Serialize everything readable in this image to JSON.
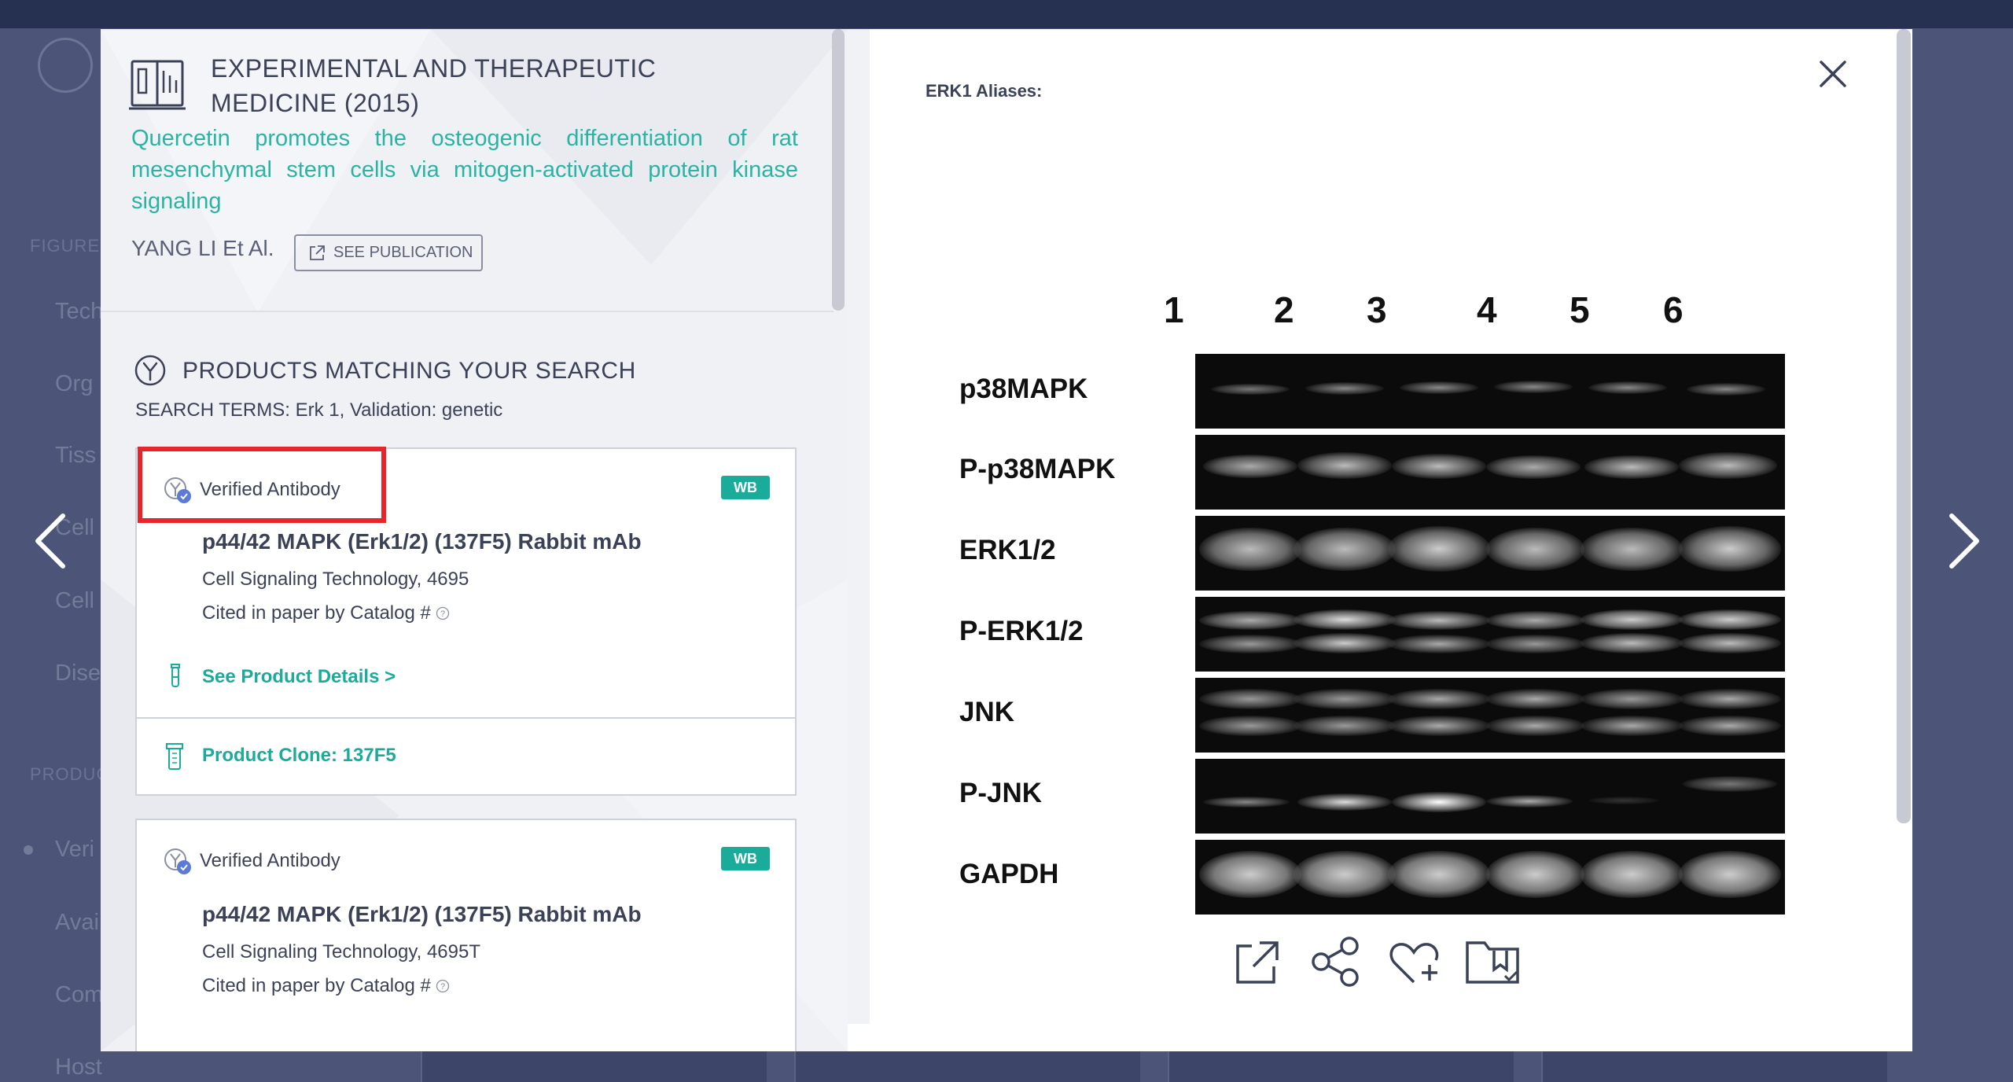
{
  "background": {
    "sidebar_heading_figures": "FIGURES",
    "sidebar_heading_products": "PRODUCTS",
    "sidebar_items": [
      "Tech",
      "Org",
      "Tiss",
      "Cell",
      "Cell",
      "Dise"
    ],
    "product_items": [
      "Veri",
      "Avai",
      "Com",
      "Host"
    ]
  },
  "publication": {
    "journal": "EXPERIMENTAL AND THERAPEUTIC MEDICINE (2015)",
    "title": "Quercetin promotes the osteogenic differentiation of rat mesenchymal stem cells via mitogen-activated protein kinase signaling",
    "authors": "YANG LI Et Al.",
    "see_publication_label": "SEE PUBLICATION"
  },
  "products": {
    "heading": "PRODUCTS MATCHING YOUR SEARCH",
    "search_terms": "SEARCH TERMS: Erk 1, Validation: genetic",
    "cards": [
      {
        "verified_label": "Verified Antibody",
        "badge": "WB",
        "name": "p44/42 MAPK (Erk1/2) (137F5) Rabbit mAb",
        "vendor": "Cell Signaling Technology, 4695",
        "cited": "Cited in paper by Catalog #",
        "details_link": "See Product Details >",
        "clone": "Product Clone: 137F5"
      },
      {
        "verified_label": "Verified Antibody",
        "badge": "WB",
        "name": "p44/42 MAPK (Erk1/2) (137F5) Rabbit mAb",
        "vendor": "Cell Signaling Technology, 4695T",
        "cited": "Cited in paper by Catalog #"
      }
    ]
  },
  "figure": {
    "aliases_label": "ERK1 Aliases:",
    "lanes": [
      "1",
      "2",
      "3",
      "4",
      "5",
      "6"
    ],
    "rows": [
      "p38MAPK",
      "P-p38MAPK",
      "ERK1/2",
      "P-ERK1/2",
      "JNK",
      "P-JNK",
      "GAPDH"
    ]
  },
  "actions": {
    "icons": [
      "open-external-icon",
      "share-icon",
      "favorite-add-icon",
      "save-folder-icon"
    ]
  },
  "colors": {
    "accent": "#1aab9b",
    "highlight": "#e8252b",
    "overlay": "#2f3a5f"
  }
}
